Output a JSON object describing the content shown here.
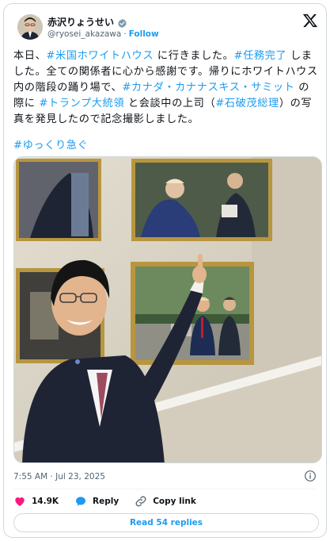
{
  "author": {
    "display_name": "赤沢りょうせい",
    "handle": "@ryosei_akazawa",
    "separator": "·",
    "follow_label": "Follow"
  },
  "tweet": {
    "text_segments": [
      {
        "text": "本日、",
        "tag": false
      },
      {
        "text": "#米国ホワイトハウス",
        "tag": true
      },
      {
        "text": " に行きました。",
        "tag": false
      },
      {
        "text": "#任務完了",
        "tag": true
      },
      {
        "text": " しました。全ての関係者に心から感謝です。帰りにホワイトハウス内の階段の踊り場で、",
        "tag": false
      },
      {
        "text": "#カナダ・カナナスキス・サミット",
        "tag": true
      },
      {
        "text": " の際に ",
        "tag": false
      },
      {
        "text": "#トランプ大統領",
        "tag": true
      },
      {
        "text": " と会談中の上司（",
        "tag": false
      },
      {
        "text": "#石破茂総理",
        "tag": true
      },
      {
        "text": "）の写真を発見したので記念撮影しました。",
        "tag": false
      }
    ],
    "hashtag_line": "#ゆっくり急ぐ",
    "timestamp": "7:55 AM · Jul 23, 2025"
  },
  "actions": {
    "like_count": "14.9K",
    "reply_label": "Reply",
    "copy_link_label": "Copy link"
  },
  "read_replies_label": "Read 54 replies",
  "colors": {
    "accent": "#1d9bf0",
    "like": "#f91880",
    "text": "#0f1419",
    "muted": "#536471"
  }
}
